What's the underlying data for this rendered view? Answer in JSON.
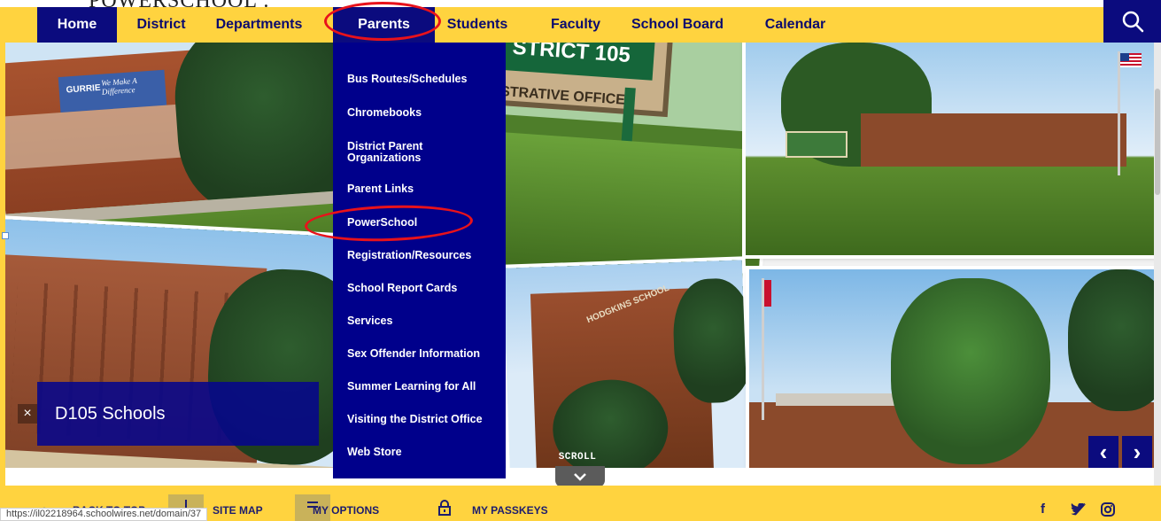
{
  "annotation": {
    "top_text": "POWERSCHOOL :"
  },
  "nav": {
    "items": [
      {
        "label": "Home"
      },
      {
        "label": "District"
      },
      {
        "label": "Departments"
      },
      {
        "label": "Parents"
      },
      {
        "label": "Students"
      },
      {
        "label": "Faculty"
      },
      {
        "label": "School Board"
      },
      {
        "label": "Calendar"
      }
    ],
    "search_icon": "search-icon"
  },
  "photos": {
    "sign_line1": "STRICT 105",
    "sign_line2": "STRATIVE OFFICE",
    "gurrie_sign": "GURRIE",
    "gurrie_slogan": "We Make A Difference",
    "hodgkins_sign": "HODGKINS SCHOOL"
  },
  "dropdown": {
    "items": [
      {
        "label": "Bus Routes/Schedules"
      },
      {
        "label": "Chromebooks"
      },
      {
        "label": "District Parent Organizations"
      },
      {
        "label": "Parent Links"
      },
      {
        "label": "PowerSchool"
      },
      {
        "label": "Registration/Resources"
      },
      {
        "label": "School Report Cards"
      },
      {
        "label": "Services"
      },
      {
        "label": "Sex Offender Information"
      },
      {
        "label": "Summer Learning for All"
      },
      {
        "label": "Visiting the District Office"
      },
      {
        "label": "Web Store"
      }
    ]
  },
  "caption": {
    "close": "×",
    "title": "D105 Schools"
  },
  "scroll": {
    "label": "SCROLL"
  },
  "carousel": {
    "prev": "‹",
    "next": "›"
  },
  "bottom": {
    "back_to_top": "BACK TO TOP",
    "site_map": "SITE MAP",
    "my_options": "MY OPTIONS",
    "my_passkeys": "MY PASSKEYS",
    "status_url": "https://il02218964.schoolwires.net/domain/37",
    "social": [
      "f",
      "twitter",
      "instagram"
    ]
  },
  "colors": {
    "nav_yellow": "#ffd33f",
    "navy": "#0b0b7e",
    "dropdown_blue": "#00008b",
    "annotation_red": "#e8121b"
  }
}
